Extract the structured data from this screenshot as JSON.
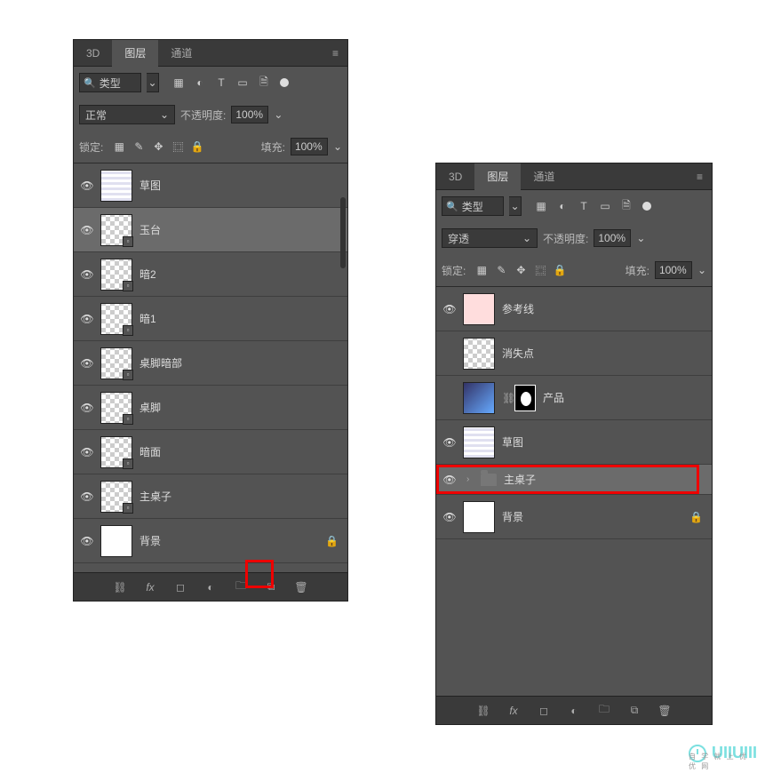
{
  "left": {
    "tabs": [
      "3D",
      "图层",
      "通道"
    ],
    "activeTab": 1,
    "searchLabel": "类型",
    "blendMode": "正常",
    "opacityLabel": "不透明度:",
    "opacityValue": "100%",
    "lockLabel": "锁定:",
    "fillLabel": "填充:",
    "fillValue": "100%",
    "layers": [
      {
        "name": "草图",
        "eye": true,
        "thumb": "stripes",
        "selected": false,
        "smart": false
      },
      {
        "name": "玉台",
        "eye": true,
        "thumb": "checker",
        "selected": true,
        "smart": true
      },
      {
        "name": "暗2",
        "eye": true,
        "thumb": "checker",
        "selected": false,
        "smart": true
      },
      {
        "name": "暗1",
        "eye": true,
        "thumb": "checker",
        "selected": false,
        "smart": true
      },
      {
        "name": "桌脚暗部",
        "eye": true,
        "thumb": "checker",
        "selected": false,
        "smart": true
      },
      {
        "name": "桌脚",
        "eye": true,
        "thumb": "checker",
        "selected": false,
        "smart": true
      },
      {
        "name": "暗面",
        "eye": true,
        "thumb": "checker",
        "selected": false,
        "smart": true
      },
      {
        "name": "主桌子",
        "eye": true,
        "thumb": "checker",
        "selected": false,
        "smart": true
      },
      {
        "name": "背景",
        "eye": true,
        "thumb": "white",
        "selected": false,
        "locked": true
      }
    ]
  },
  "right": {
    "tabs": [
      "3D",
      "图层",
      "通道"
    ],
    "activeTab": 1,
    "searchLabel": "类型",
    "blendMode": "穿透",
    "opacityLabel": "不透明度:",
    "opacityValue": "100%",
    "lockLabel": "锁定:",
    "fillLabel": "填充:",
    "fillValue": "100%",
    "layers": [
      {
        "name": "参考线",
        "eye": true,
        "thumb": "pink"
      },
      {
        "name": "消失点",
        "eye": false,
        "thumb": "checker"
      },
      {
        "name": "产品",
        "eye": false,
        "thumb": "product",
        "hasMask": true,
        "linked": true
      },
      {
        "name": "草图",
        "eye": true,
        "thumb": "stripes"
      },
      {
        "name": "主桌子",
        "eye": true,
        "type": "group",
        "selected": true,
        "highlight": true
      },
      {
        "name": "背景",
        "eye": true,
        "thumb": "white",
        "locked": true
      }
    ]
  },
  "watermark": {
    "text": "UIIUIII",
    "sub": "自 学 就 上 优 优 网"
  }
}
